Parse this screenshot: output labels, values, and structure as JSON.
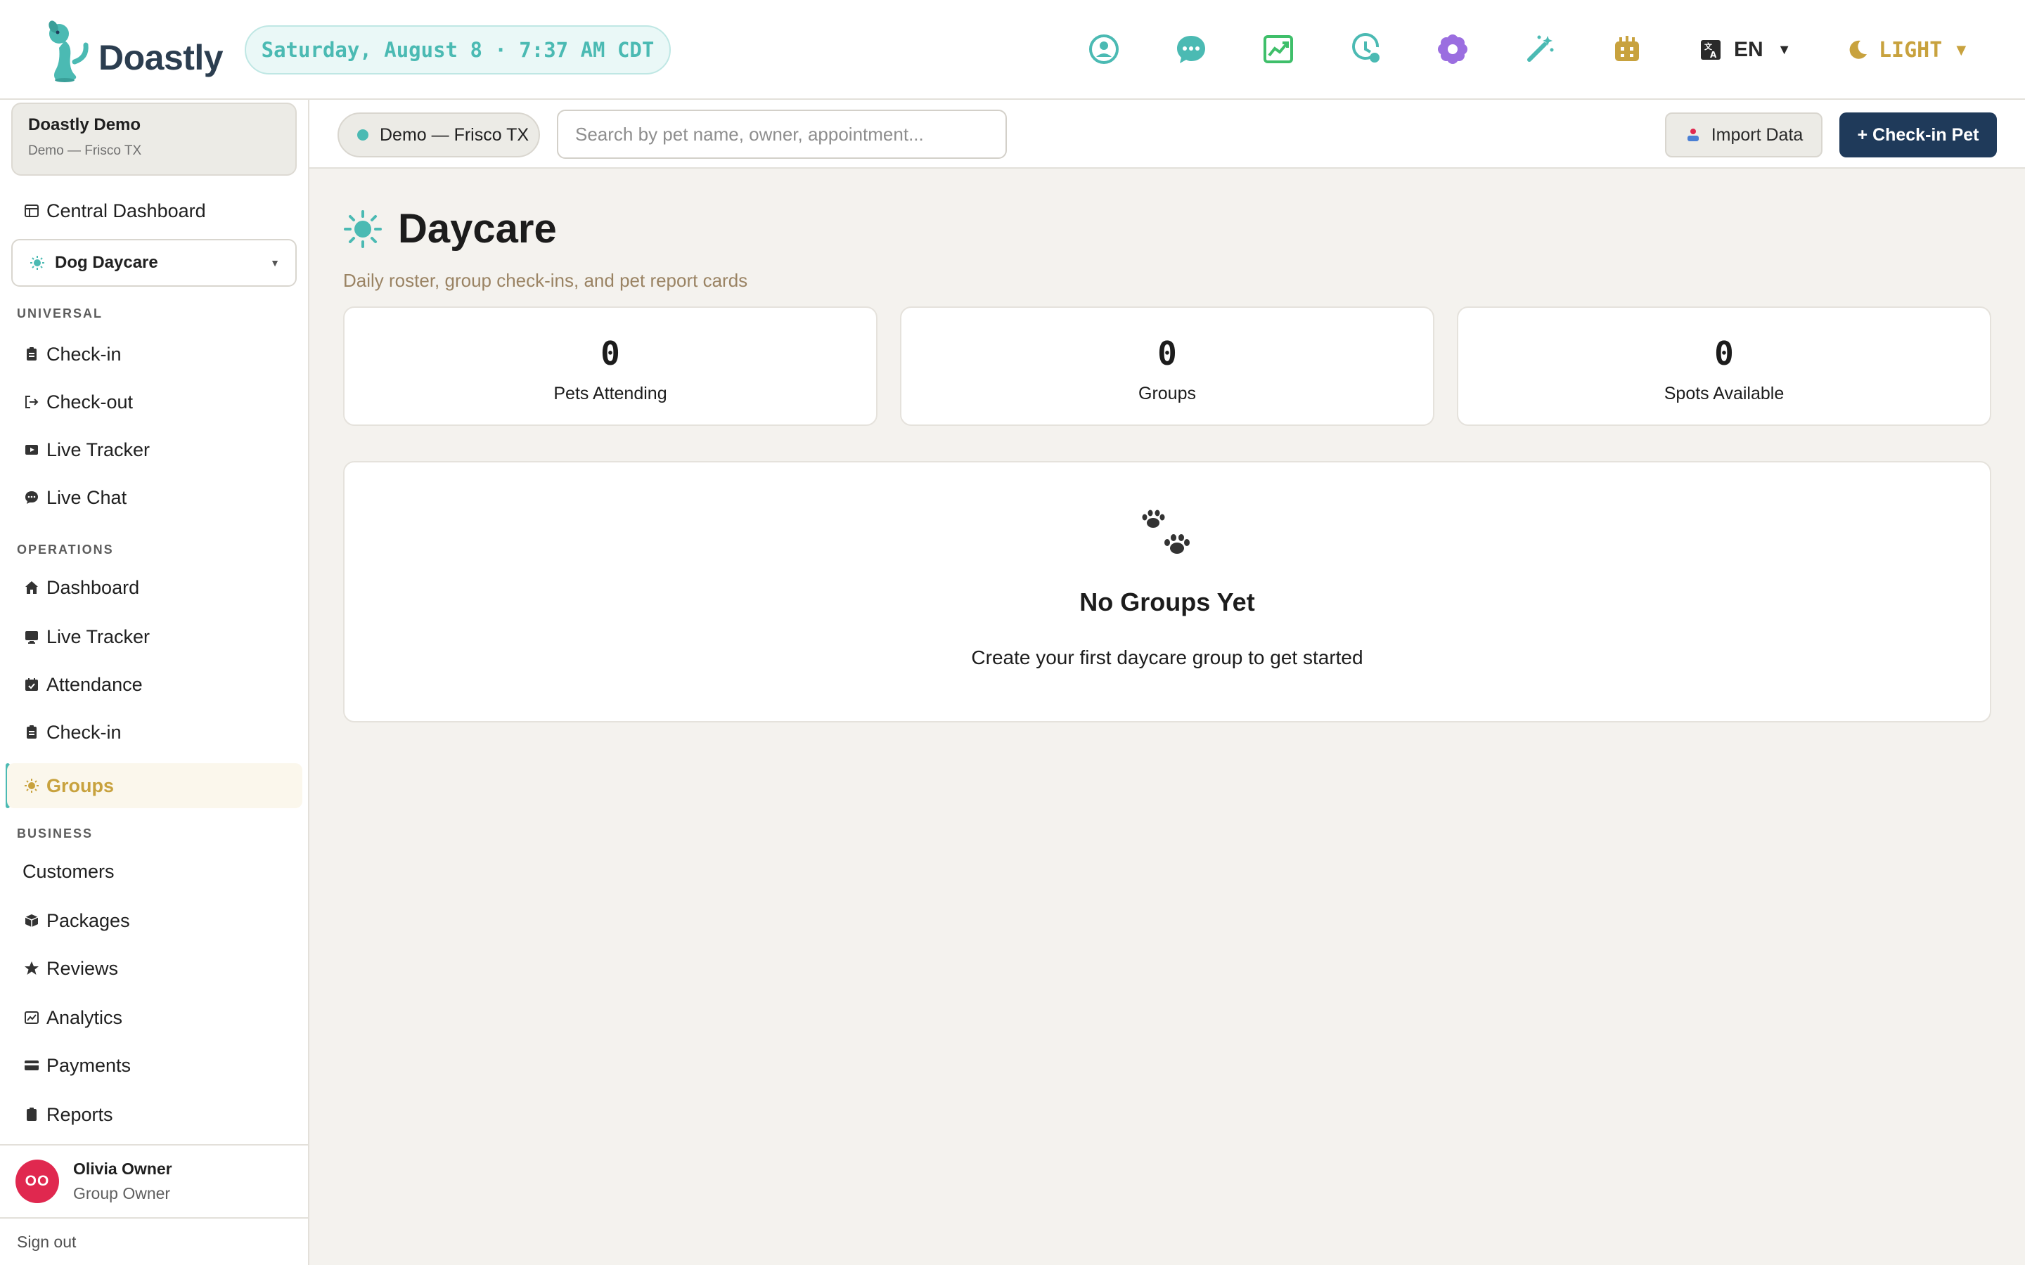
{
  "app": {
    "name": "Doastly",
    "datetime": "Saturday, August 8 · 7:37 AM CDT"
  },
  "topbar": {
    "icons": [
      "support-icon",
      "chat-icon",
      "analytics-chart-icon",
      "schedule-clock-icon",
      "settings-flower-icon",
      "magic-wand-icon",
      "robot-icon"
    ],
    "language": "EN",
    "theme": "LIGHT"
  },
  "sidebar": {
    "org_name": "Doastly Demo",
    "org_location": "Demo — Frisco TX",
    "central_dashboard": "Central Dashboard",
    "service_selected": "Dog Daycare",
    "sections": {
      "universal": "UNIVERSAL",
      "operations": "OPERATIONS",
      "business": "BUSINESS"
    },
    "universal_items": [
      "Check-in",
      "Check-out",
      "Live Tracker",
      "Live Chat"
    ],
    "operations_items": [
      "Dashboard",
      "Live Tracker",
      "Attendance",
      "Check-in",
      "Groups"
    ],
    "business_items": [
      "Customers",
      "Packages",
      "Reviews",
      "Analytics",
      "Payments",
      "Reports"
    ],
    "active_item": "Groups",
    "user": {
      "initials": "OO",
      "name": "Olivia Owner",
      "role": "Group Owner"
    },
    "sign_out": "Sign out"
  },
  "subheader": {
    "location": "Demo — Frisco TX",
    "search_placeholder": "Search by pet name, owner, appointment...",
    "import_label": "Import Data",
    "checkin_label": "+ Check-in Pet"
  },
  "main": {
    "title": "Daycare",
    "subtitle": "Daily roster, group check-ins, and pet report cards",
    "stats": [
      {
        "value": "0",
        "label": "Pets Attending"
      },
      {
        "value": "0",
        "label": "Groups"
      },
      {
        "value": "0",
        "label": "Spots Available"
      }
    ],
    "empty_title": "No Groups Yet",
    "empty_desc": "Create your first daycare group to get started"
  },
  "colors": {
    "accent_teal": "#4bbab3",
    "accent_gold": "#c8a23e",
    "primary_navy": "#1f3a5a",
    "avatar_red": "#e0284f"
  }
}
